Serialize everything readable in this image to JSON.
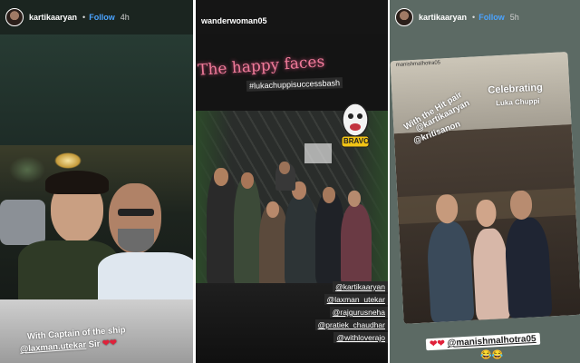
{
  "stories": [
    {
      "username": "kartikaaryan",
      "follow": "Follow",
      "age": "4h",
      "caption_line1": "With Captain of the ship",
      "mention": "@laxman.utekar",
      "caption_suffix": "Sir",
      "hearts": "❤❤"
    },
    {
      "username": "wanderwoman05",
      "title": "The happy faces",
      "hashtag": "#lukachuppisuccessbash",
      "sticker_text": "BRAVO",
      "tags": [
        "@kartikaaryan",
        "@laxman_utekar",
        "@rajgurusneha",
        "@pratiek_chaudhar",
        "@withloverajo"
      ]
    },
    {
      "username": "kartikaaryan",
      "follow": "Follow",
      "age": "5h",
      "inner_username": "manishmalhotra05",
      "inner_text1": "With the Hit pair",
      "inner_mention1": "@kartikaaryan",
      "inner_mention2": "@kritisanon",
      "inner_celebrating": "Celebrating",
      "inner_film": "Luka Chuppi",
      "bottom_mention": "@manishmalhotra05",
      "bottom_hearts": "❤❤",
      "bottom_emoji": "😂😂"
    }
  ],
  "colors": {
    "follow_blue": "#4aa3ff",
    "neon_pink": "#f07b9a"
  }
}
